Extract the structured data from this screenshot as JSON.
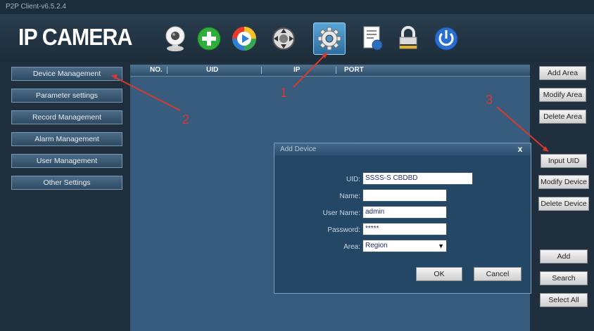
{
  "window": {
    "title": "P2P Client-v6.5.2.4"
  },
  "header": {
    "logo": "IP CAMERA",
    "toolbar": [
      {
        "name": "camera-icon"
      },
      {
        "name": "add-icon"
      },
      {
        "name": "playback-icon"
      },
      {
        "name": "ptz-icon"
      },
      {
        "name": "settings-icon",
        "selected": true
      },
      {
        "name": "log-icon"
      },
      {
        "name": "lock-icon"
      },
      {
        "name": "power-icon"
      }
    ]
  },
  "sidebar": {
    "items": [
      {
        "label": "Device Management"
      },
      {
        "label": "Parameter settings"
      },
      {
        "label": "Record Management"
      },
      {
        "label": "Alarm Management"
      },
      {
        "label": "User Management"
      },
      {
        "label": "Other Settings"
      }
    ]
  },
  "device_table": {
    "columns": [
      "NO.",
      "UID",
      "IP",
      "PORT"
    ]
  },
  "right_panel": {
    "buttons": [
      {
        "label": "Add Area"
      },
      {
        "label": "Modify Area"
      },
      {
        "label": "Delete Area"
      },
      {
        "label": "Input UID"
      },
      {
        "label": "Modify Device"
      },
      {
        "label": "Delete Device"
      },
      {
        "label": "Add"
      },
      {
        "label": "Search"
      },
      {
        "label": "Select All"
      }
    ]
  },
  "dialog": {
    "title": "Add Device",
    "close": "x",
    "fields": [
      {
        "label": "UID:",
        "value": "SSSS-S      CBDBD"
      },
      {
        "label": "Name:",
        "value": ""
      },
      {
        "label": "User Name:",
        "value": "admin"
      },
      {
        "label": "Password:",
        "value": "*****"
      },
      {
        "label": "Area:",
        "value": "Region"
      }
    ],
    "ok": "OK",
    "cancel": "Cancel"
  },
  "annotations": [
    "1",
    "2",
    "3"
  ],
  "colors": {
    "annotation": "#d63a30",
    "accent": "#4c92c4"
  }
}
